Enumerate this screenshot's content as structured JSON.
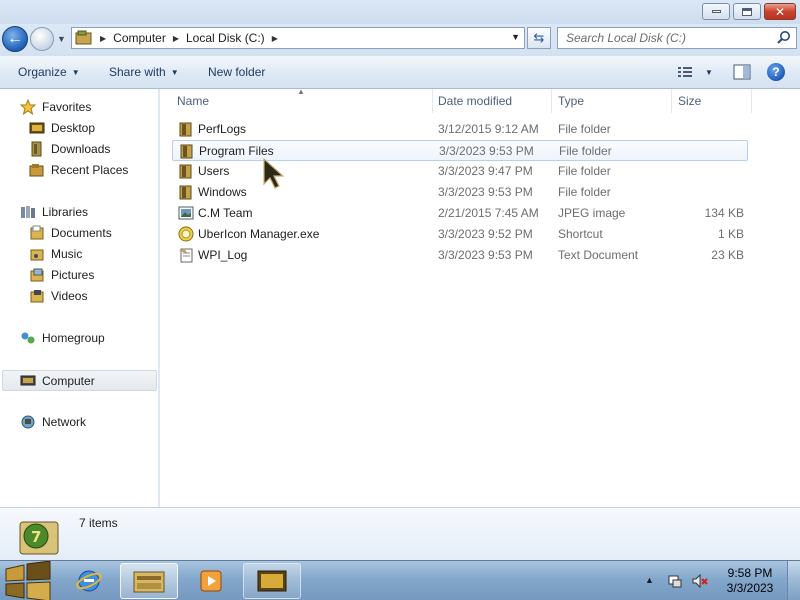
{
  "window": {
    "controls": {
      "minimize": "minimize",
      "maximize": "maximize",
      "close": "✕"
    }
  },
  "address": {
    "breadcrumbs": [
      "Computer",
      "Local Disk (C:)"
    ],
    "search_placeholder": "Search Local Disk (C:)"
  },
  "toolbar": {
    "organize": "Organize",
    "share_with": "Share with",
    "new_folder": "New folder",
    "help": "?"
  },
  "nav": {
    "favorites": "Favorites",
    "desktop": "Desktop",
    "downloads": "Downloads",
    "recent_places": "Recent Places",
    "libraries": "Libraries",
    "documents": "Documents",
    "music": "Music",
    "pictures": "Pictures",
    "videos": "Videos",
    "homegroup": "Homegroup",
    "computer": "Computer",
    "network": "Network"
  },
  "columns": {
    "name": "Name",
    "date_modified": "Date modified",
    "type": "Type",
    "size": "Size"
  },
  "files": [
    {
      "name": "PerfLogs",
      "date": "3/12/2015 9:12 AM",
      "type": "File folder",
      "size": "",
      "icon": "folder-icon"
    },
    {
      "name": "Program Files",
      "date": "3/3/2023 9:53 PM",
      "type": "File folder",
      "size": "",
      "icon": "folder-icon"
    },
    {
      "name": "Users",
      "date": "3/3/2023 9:47 PM",
      "type": "File folder",
      "size": "",
      "icon": "folder-icon"
    },
    {
      "name": "Windows",
      "date": "3/3/2023 9:53 PM",
      "type": "File folder",
      "size": "",
      "icon": "folder-icon"
    },
    {
      "name": "C.M Team",
      "date": "2/21/2015 7:45 AM",
      "type": "JPEG image",
      "size": "134 KB",
      "icon": "image-file-icon"
    },
    {
      "name": "UberIcon Manager.exe",
      "date": "3/3/2023 9:52 PM",
      "type": "Shortcut",
      "size": "1 KB",
      "icon": "shortcut-icon"
    },
    {
      "name": "WPI_Log",
      "date": "3/3/2023 9:53 PM",
      "type": "Text Document",
      "size": "23 KB",
      "icon": "text-document-icon"
    }
  ],
  "status": {
    "item_count": "7 items"
  },
  "taskbar": {
    "time": "9:58 PM",
    "date": "3/3/2023"
  },
  "colors": {
    "accent": "#1f5fb4",
    "toolbar_text": "#1e395b",
    "hover_border": "#b8d0ee"
  }
}
